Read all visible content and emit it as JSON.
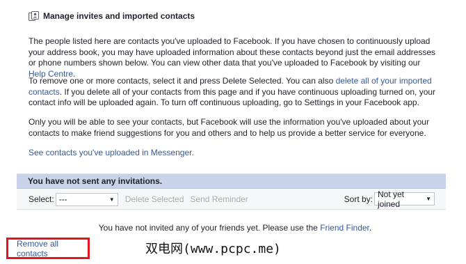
{
  "header": {
    "icon": "contacts-icon",
    "title": "Manage invites and imported contacts"
  },
  "paragraphs": {
    "p1_text": "The people listed here are contacts you've uploaded to Facebook. If you have chosen to continuously upload your address book, you may have uploaded information about these contacts beyond just the email addresses or phone numbers shown below. You can view other data that you've uploaded to Facebook by visiting our ",
    "p1_link": "Help Centre",
    "p1_end": ".",
    "p2_text_a": "To remove one or more contacts, select it and press Delete Selected. You can also ",
    "p2_link": "delete all of your imported contacts",
    "p2_text_b": ". If you delete all of your contacts from this page and if you have continuous uploading turned on, your contact info will be uploaded again. To turn off continuous uploading, go to Settings in your Facebook app.",
    "p3_text": "Only you will be able to see your contacts, but Facebook will use the information you've uploaded about your contacts to make friend suggestions for you and others and to help us provide a better service for everyone.",
    "p4_link": "See contacts you've uploaded in Messenger."
  },
  "invites": {
    "bar_label": "You have not sent any invitations.",
    "select_label": "Select:",
    "select_value": "---",
    "delete_selected": "Delete Selected",
    "send_reminder": "Send Reminder",
    "sort_label": "Sort by:",
    "sort_value": "Not yet joined",
    "empty_msg": "You have not invited any of your friends yet. Please use the ",
    "friend_finder_link": "Friend Finder",
    "empty_msg_end": "."
  },
  "footer": {
    "remove_all": "Remove all contacts"
  },
  "watermark": "双电网(www.pcpc.me)",
  "colors": {
    "link": "#365899",
    "bar_bg": "#c8d2e8",
    "highlight_border": "#e2161f",
    "disabled_text": "#a8abaf"
  }
}
